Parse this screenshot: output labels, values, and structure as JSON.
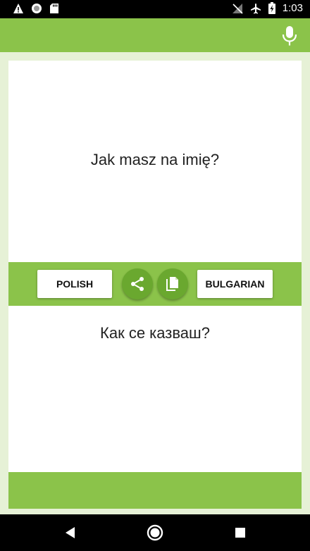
{
  "status_bar": {
    "time": "1:03",
    "left_icons": [
      "warning-icon",
      "circle-icon",
      "sd-card-icon"
    ],
    "right_icons": [
      "no-signal-icon",
      "airplane-icon",
      "battery-charging-icon"
    ]
  },
  "app_bar": {
    "mic_icon": "mic-icon",
    "accent_color": "#8bc34a"
  },
  "translation": {
    "source_text": "Jak masz na imię?",
    "target_text": "Как се казваш?"
  },
  "toolbar": {
    "source_language": "POLISH",
    "target_language": "BULGARIAN",
    "share_icon": "share-icon",
    "copy_icon": "copy-icon"
  },
  "nav_bar": {
    "back_icon": "back-icon",
    "home_icon": "home-icon",
    "recents_icon": "recents-icon"
  }
}
